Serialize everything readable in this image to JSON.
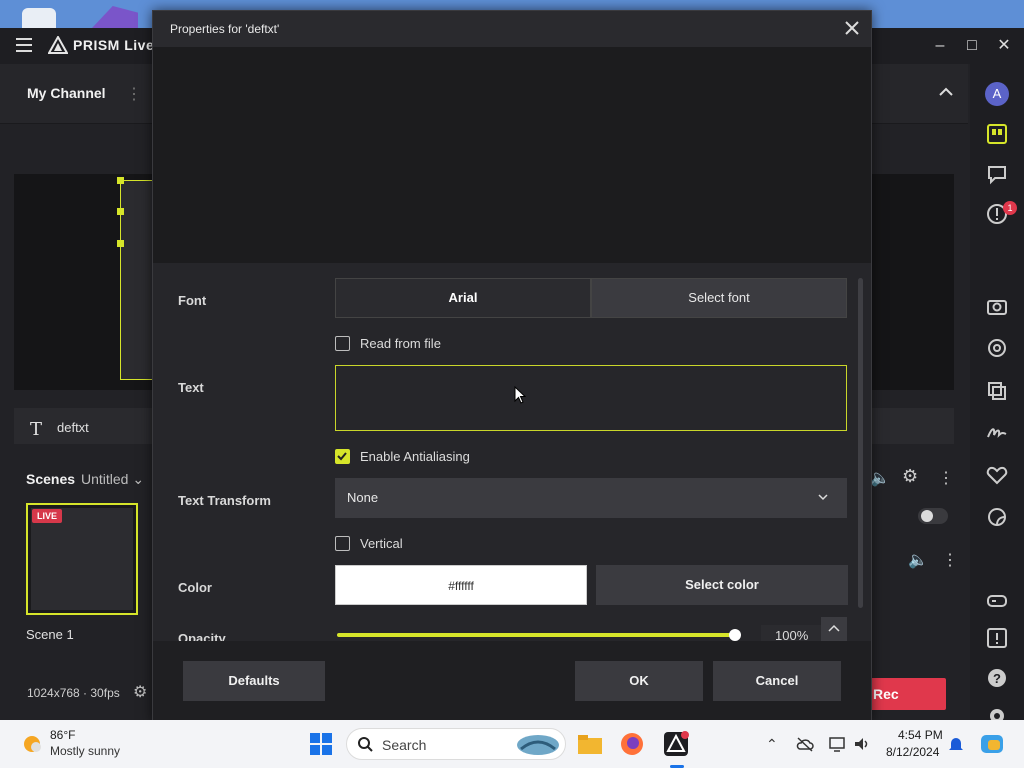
{
  "app": {
    "title": "PRISM Live S",
    "channel_name": "My Channel",
    "source_name": "deftxt",
    "scenes_title": "Scenes",
    "scene_collection": "Untitled",
    "scene_item_label": "Scene 1",
    "live_badge": "LIVE",
    "status_resolution": "1024x768 · 30fps",
    "rec_label": "Rec",
    "avatar_letter": "A",
    "notification_count": "1"
  },
  "dialog": {
    "title": "Properties for 'deftxt'",
    "font_label": "Font",
    "font_value": "Arial",
    "select_font_label": "Select font",
    "read_from_file_label": "Read from file",
    "read_from_file_checked": false,
    "text_label": "Text",
    "text_value": "",
    "antialiasing_label": "Enable Antialiasing",
    "antialiasing_checked": true,
    "text_transform_label": "Text Transform",
    "text_transform_value": "None",
    "vertical_label": "Vertical",
    "vertical_checked": false,
    "color_label": "Color",
    "color_value": "#ffffff",
    "select_color_label": "Select color",
    "opacity_label": "Opacity",
    "opacity_value": "100%",
    "defaults_label": "Defaults",
    "ok_label": "OK",
    "cancel_label": "Cancel"
  },
  "taskbar": {
    "weather_temp": "86°F",
    "weather_desc": "Mostly sunny",
    "search_placeholder": "Search",
    "time": "4:54 PM",
    "date": "8/12/2024"
  },
  "colors": {
    "accent": "#d6e52a",
    "live_red": "#e0384c",
    "dialog_bg": "#26262a"
  },
  "icons": [
    "hamburger-icon",
    "prism-logo-icon",
    "minimize-icon",
    "maximize-icon",
    "close-icon",
    "chevron-up-icon",
    "text-source-icon",
    "chevron-down-icon",
    "gear-icon",
    "volume-icon",
    "more-icon",
    "chat-icon",
    "alert-icon",
    "camera-icon",
    "beauty-icon",
    "layers-icon",
    "signature-icon",
    "heart-icon",
    "sticker-icon",
    "gamepad-icon",
    "question-icon",
    "windows-logo-icon",
    "search-icon"
  ]
}
